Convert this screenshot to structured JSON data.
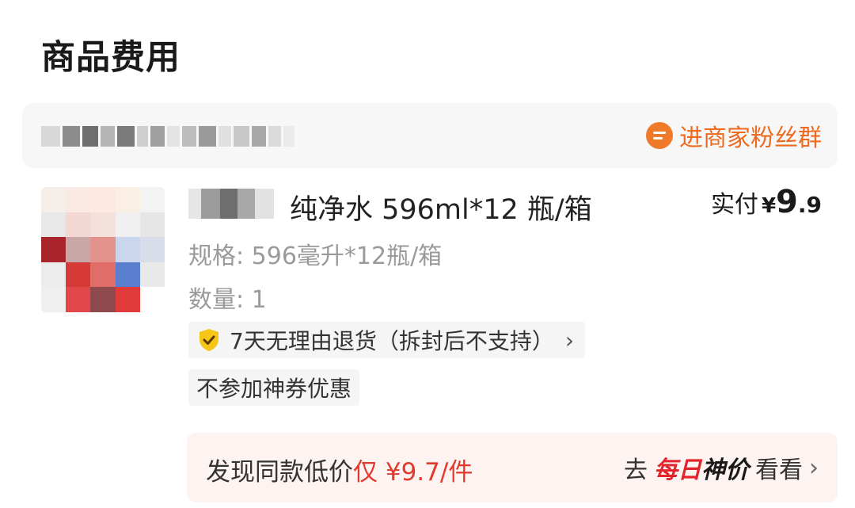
{
  "section": {
    "title": "商品费用"
  },
  "store": {
    "fan_group_label": "进商家粉丝群",
    "fan_group_icon": "chat-bubble-icon",
    "accent_color": "#ee6a1f"
  },
  "product": {
    "title": "纯净水 596ml*12 瓶/箱",
    "spec": "规格: 596毫升*12瓶/箱",
    "quantity": "数量: 1",
    "price": {
      "label": "实付",
      "currency": "¥",
      "integer": "9",
      "decimal": ".9"
    }
  },
  "tags": {
    "return_policy": "7天无理由退货（拆封后不支持）",
    "return_icon": "shield-check-icon",
    "return_arrow": "›",
    "coupon": "不参加神券优惠"
  },
  "low_price": {
    "prefix": "发现同款低价",
    "highlight": "仅 ¥9.7/件",
    "go": "去",
    "logo_red": "每日",
    "logo_dark": "神价",
    "look": "看看",
    "arrow": "›",
    "highlight_color": "#e2392f"
  }
}
